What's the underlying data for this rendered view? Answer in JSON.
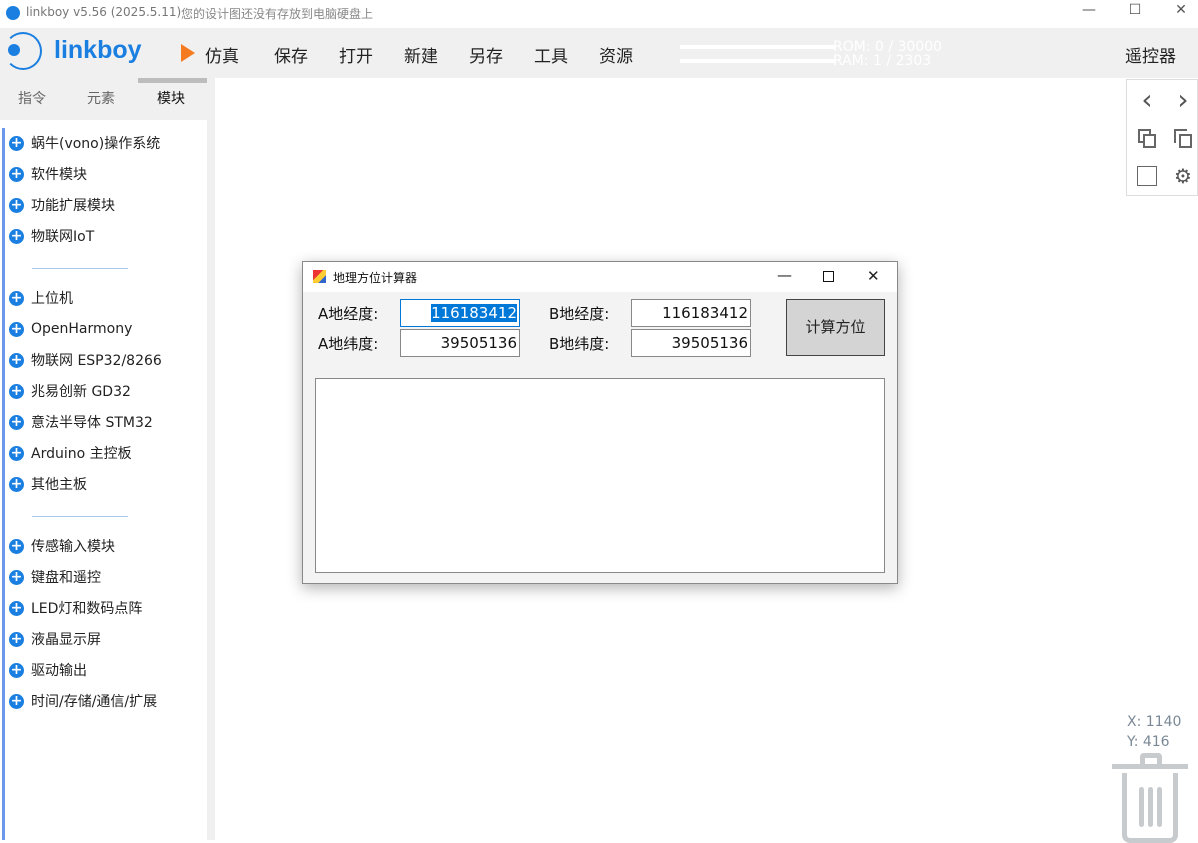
{
  "titlebar": {
    "app": "linkboy v5.56 (2025.5.11)",
    "message": "您的设计图还没有存放到电脑硬盘上",
    "minimize": "—",
    "maximize": "☐",
    "close": "✕"
  },
  "toolbar": {
    "brand": "linkboy",
    "simulate": "仿真",
    "save": "保存",
    "open": "打开",
    "new": "新建",
    "save_as": "另存",
    "tools": "工具",
    "resources": "资源",
    "rom": "ROM: 0 / 30000",
    "ram": "RAM: 1 / 2303",
    "remote": "遥控器"
  },
  "tabs": [
    "指令",
    "元素",
    "模块"
  ],
  "sidebar": {
    "group1": [
      "蜗牛(vono)操作系统",
      "软件模块",
      "功能扩展模块",
      "物联网IoT"
    ],
    "group2": [
      "上位机",
      "OpenHarmony",
      "物联网 ESP32/8266",
      "兆易创新 GD32",
      "意法半导体 STM32",
      "Arduino 主控板",
      "其他主板"
    ],
    "group3": [
      "传感输入模块",
      "键盘和遥控",
      "LED灯和数码点阵",
      "液晶显示屏",
      "驱动输出",
      "时间/存储/通信/扩展"
    ]
  },
  "tools": {
    "back": "‹",
    "forward": "›"
  },
  "coords": {
    "x": "X: 1140",
    "y": "Y: 416"
  },
  "dialog": {
    "title": "地理方位计算器",
    "a_lon_label": "A地经度:",
    "a_lat_label": "A地纬度:",
    "b_lon_label": "B地经度:",
    "b_lat_label": "B地纬度:",
    "a_lon": "116183412",
    "a_lat": "39505136",
    "b_lon": "116183412",
    "b_lat": "39505136",
    "compute": "计算方位",
    "output": ""
  }
}
